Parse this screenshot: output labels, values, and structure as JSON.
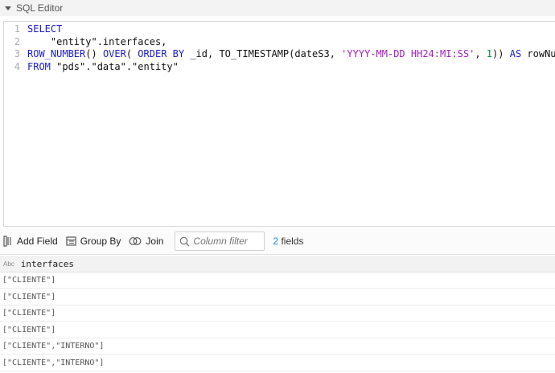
{
  "panel": {
    "title": "SQL Editor"
  },
  "editor": {
    "lines": [
      {
        "number": "1",
        "tokens": [
          {
            "text": "SELECT",
            "kind": "kw"
          }
        ]
      },
      {
        "number": "2",
        "tokens": [
          {
            "text": "    \"entity\".interfaces,",
            "kind": "tok"
          }
        ]
      },
      {
        "number": "3",
        "tokens": [
          {
            "text": "ROW_NUMBER",
            "kind": "kw"
          },
          {
            "text": "() ",
            "kind": "tok"
          },
          {
            "text": "OVER",
            "kind": "kw"
          },
          {
            "text": "( ",
            "kind": "tok"
          },
          {
            "text": "ORDER BY",
            "kind": "kw"
          },
          {
            "text": " _id, TO_TIMESTAMP(dateS3, ",
            "kind": "tok"
          },
          {
            "text": "'YYYY-MM-DD HH24:MI:SS'",
            "kind": "str"
          },
          {
            "text": ", ",
            "kind": "tok"
          },
          {
            "text": "1",
            "kind": "num"
          },
          {
            "text": ")) ",
            "kind": "tok"
          },
          {
            "text": "AS",
            "kind": "kw"
          },
          {
            "text": " rowNumber",
            "kind": "tok"
          }
        ]
      },
      {
        "number": "4",
        "tokens": [
          {
            "text": "FROM",
            "kind": "kw"
          },
          {
            "text": " \"pds\".\"data\".\"entity\"",
            "kind": "tok"
          }
        ]
      }
    ]
  },
  "toolbar": {
    "add_field_label": "Add Field",
    "group_by_label": "Group By",
    "join_label": "Join",
    "column_filter_placeholder": "Column filter",
    "field_count_number": "2",
    "field_count_suffix": " fields"
  },
  "grid": {
    "column": {
      "type_badge": "Abc",
      "name": "interfaces"
    },
    "rows": [
      "[\"CLIENTE\"]",
      "[\"CLIENTE\"]",
      "[\"CLIENTE\"]",
      "[\"CLIENTE\"]",
      "[\"CLIENTE\",\"INTERNO\"]",
      "[\"CLIENTE\",\"INTERNO\"]"
    ]
  }
}
